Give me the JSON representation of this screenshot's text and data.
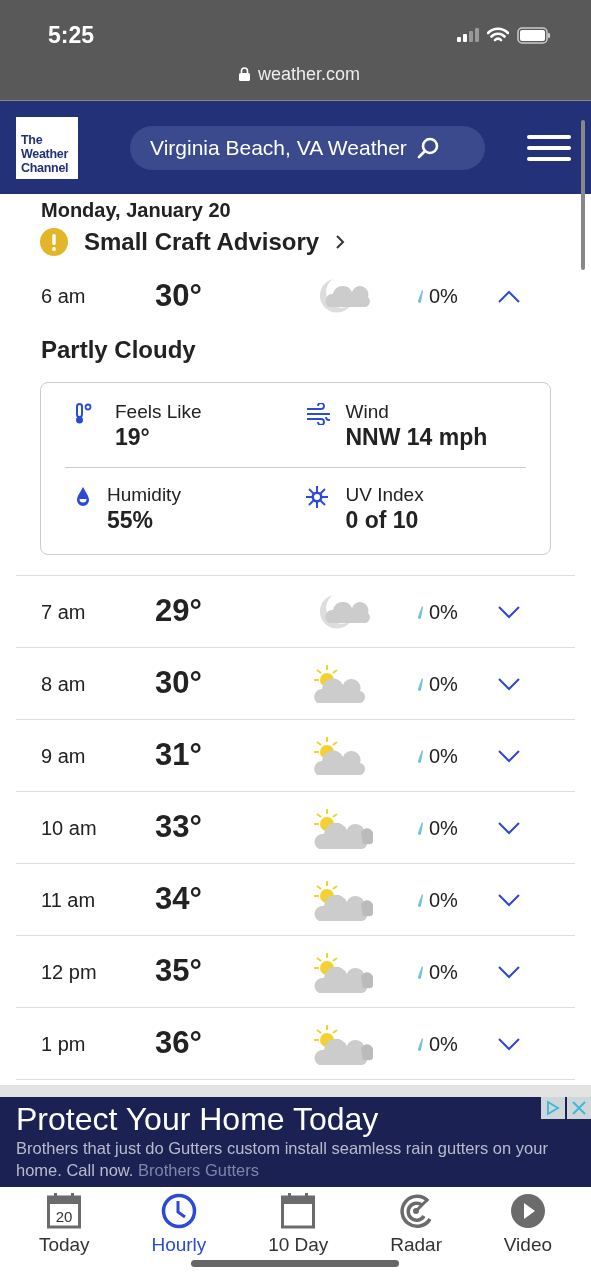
{
  "status_bar": {
    "time": "5:25",
    "url": "weather.com"
  },
  "header": {
    "logo": [
      "The",
      "Weather",
      "Channel"
    ],
    "search": "Virginia Beach, VA Weather"
  },
  "date_heading": "Monday, January 20",
  "alert": {
    "title": "Small Craft Advisory"
  },
  "hours": [
    {
      "time": "6 am",
      "temp": "30°",
      "kind": "night-cloudy",
      "precip": "0%",
      "expanded": true,
      "condition": "Partly Cloudy",
      "details": [
        {
          "kind": "feels",
          "label": "Feels Like",
          "value": "19°"
        },
        {
          "kind": "wind",
          "label": "Wind",
          "value": "NNW 14 mph"
        },
        {
          "kind": "humidity",
          "label": "Humidity",
          "value": "55%"
        },
        {
          "kind": "uv",
          "label": "UV Index",
          "value": "0 of 10"
        }
      ]
    },
    {
      "time": "7 am",
      "temp": "29°",
      "kind": "night-cloudy",
      "precip": "0%",
      "expanded": false
    },
    {
      "time": "8 am",
      "temp": "30°",
      "kind": "sun-cloudy",
      "precip": "0%",
      "expanded": false
    },
    {
      "time": "9 am",
      "temp": "31°",
      "kind": "sun-cloudy",
      "precip": "0%",
      "expanded": false
    },
    {
      "time": "10 am",
      "temp": "33°",
      "kind": "sun-clouds",
      "precip": "0%",
      "expanded": false
    },
    {
      "time": "11 am",
      "temp": "34°",
      "kind": "sun-clouds",
      "precip": "0%",
      "expanded": false
    },
    {
      "time": "12 pm",
      "temp": "35°",
      "kind": "sun-clouds",
      "precip": "0%",
      "expanded": false
    },
    {
      "time": "1 pm",
      "temp": "36°",
      "kind": "sun-clouds",
      "precip": "0%",
      "expanded": false
    }
  ],
  "ad": {
    "title": "Protect Your Home Today",
    "body": "Brothers that just do Gutters custom install seamless rain gutters on your home. Call now.",
    "sponsor": "Brothers Gutters"
  },
  "tabs": [
    {
      "label": "Today",
      "kind": "calendar-day",
      "icon_text": "20",
      "selected": false
    },
    {
      "label": "Hourly",
      "kind": "clock",
      "selected": true
    },
    {
      "label": "10 Day",
      "kind": "calendar",
      "selected": false
    },
    {
      "label": "Radar",
      "kind": "radar",
      "selected": false
    },
    {
      "label": "Video",
      "kind": "play",
      "selected": false
    }
  ]
}
